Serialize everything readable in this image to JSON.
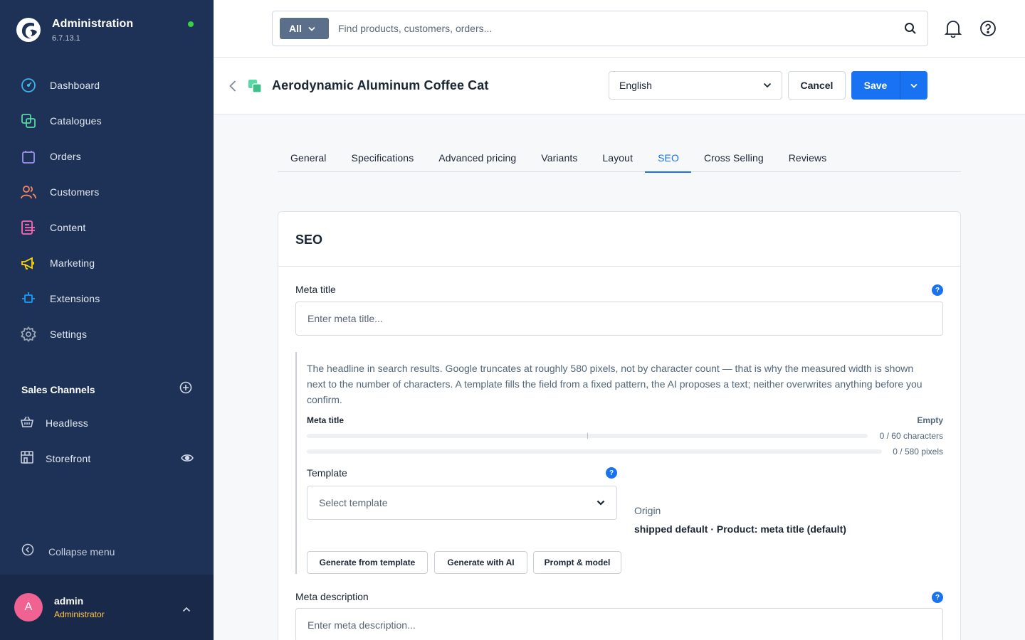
{
  "app": {
    "title": "Administration",
    "version": "6.7.13.1"
  },
  "sidebar": {
    "items": [
      {
        "label": "Dashboard",
        "icon": "dashboard-icon",
        "color": "#3db4e8"
      },
      {
        "label": "Catalogues",
        "icon": "catalogue-icon",
        "color": "#57d9a3"
      },
      {
        "label": "Orders",
        "icon": "orders-icon",
        "color": "#a092f0"
      },
      {
        "label": "Customers",
        "icon": "customers-icon",
        "color": "#f88962"
      },
      {
        "label": "Content",
        "icon": "content-icon",
        "color": "#ff68b4"
      },
      {
        "label": "Marketing",
        "icon": "marketing-icon",
        "color": "#ffd700"
      },
      {
        "label": "Extensions",
        "icon": "extensions-icon",
        "color": "#189eff"
      },
      {
        "label": "Settings",
        "icon": "settings-icon",
        "color": "#9aa8b5"
      }
    ],
    "sales_channels": {
      "title": "Sales Channels",
      "items": [
        {
          "label": "Headless",
          "icon": "basket-icon"
        },
        {
          "label": "Storefront",
          "icon": "storefront-icon"
        }
      ]
    },
    "collapse_label": "Collapse menu"
  },
  "user": {
    "initial": "A",
    "name": "admin",
    "role": "Administrator"
  },
  "search": {
    "type_label": "All",
    "placeholder": "Find products, customers, orders..."
  },
  "smartbar": {
    "title": "Aerodynamic Aluminum Coffee Cat",
    "language": "English",
    "cancel_label": "Cancel",
    "save_label": "Save"
  },
  "tabs": [
    {
      "label": "General",
      "active": false
    },
    {
      "label": "Specifications",
      "active": false
    },
    {
      "label": "Advanced pricing",
      "active": false
    },
    {
      "label": "Variants",
      "active": false
    },
    {
      "label": "Layout",
      "active": false
    },
    {
      "label": "SEO",
      "active": true
    },
    {
      "label": "Cross Selling",
      "active": false
    },
    {
      "label": "Reviews",
      "active": false
    }
  ],
  "seo": {
    "card_title": "SEO",
    "meta_title": {
      "label": "Meta title",
      "placeholder": "Enter meta title...",
      "help": "?"
    },
    "helper_text": "The headline in search results. Google truncates at roughly 580 pixels, not by character count — that is why the measured width is shown next to the number of characters. A template fills the field from a fixed pattern, the AI proposes a text; neither overwrites anything before you confirm.",
    "meter": {
      "title": "Meta title",
      "status": "Empty",
      "characters": "0 / 60 characters",
      "pixels": "0 / 580 pixels",
      "characters_fill": 0,
      "pixels_fill": 0
    },
    "template": {
      "label": "Template",
      "placeholder": "Select template",
      "help": "?"
    },
    "origin": {
      "label": "Origin",
      "value": "shipped default · Product: meta title (default)"
    },
    "buttons": {
      "generate_template": "Generate from template",
      "generate_ai": "Generate with AI",
      "prompt_model": "Prompt & model"
    },
    "meta_description": {
      "label": "Meta description",
      "placeholder": "Enter meta description...",
      "help": "?"
    }
  },
  "colors": {
    "sidebar_bg": "#1e3258",
    "accent": "#1872f2",
    "online": "#37d046",
    "avatar": "#f06292",
    "role": "#ffc94d"
  }
}
